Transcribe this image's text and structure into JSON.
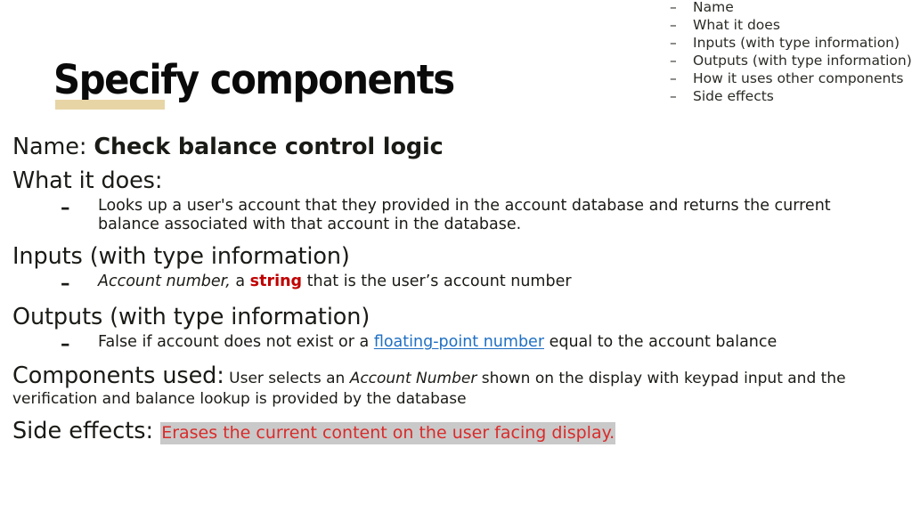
{
  "slide": {
    "title": "Specify components",
    "accent_underline_color": "#e8d5a6",
    "background_color": "#ffffff",
    "text_color": "#1a1a16"
  },
  "reference_list": {
    "dash": "–",
    "items": [
      "Name",
      "What it does",
      "Inputs (with type information)",
      "Outputs (with type information)",
      "How it uses other components",
      "Side effects"
    ]
  },
  "bullet_dash": "–",
  "sections": {
    "name": {
      "label": "Name:",
      "value": "Check balance control logic"
    },
    "what_it_does": {
      "label": "What it does:",
      "bullet": "Looks up a user's account that they provided in the account database and returns the current balance associated with that account in the database."
    },
    "inputs": {
      "label": "Inputs (with type information)",
      "bullet_pre_italic": "Account number,",
      "bullet_mid": " a ",
      "bullet_keyword": "string",
      "bullet_keyword_color": "#c00000",
      "bullet_post": " that is the user’s account number"
    },
    "outputs": {
      "label": "Outputs (with type information)",
      "bullet_pre": "False if account does not exist or a ",
      "bullet_link": "floating-point number",
      "bullet_link_color": "#1f6fc4",
      "bullet_post": " equal to the account balance"
    },
    "components_used": {
      "label": "Components used:",
      "text_pre": " User selects an ",
      "text_italic": "Account Number",
      "text_post": " shown on the display with keypad input and the verification and balance lookup is provided by the database"
    },
    "side_effects": {
      "label": "Side effects:",
      "highlighted_text": "Erases the current content on the user facing display.",
      "highlight_background": "#c9c9c9",
      "highlight_text_color": "#d92b2b"
    }
  }
}
